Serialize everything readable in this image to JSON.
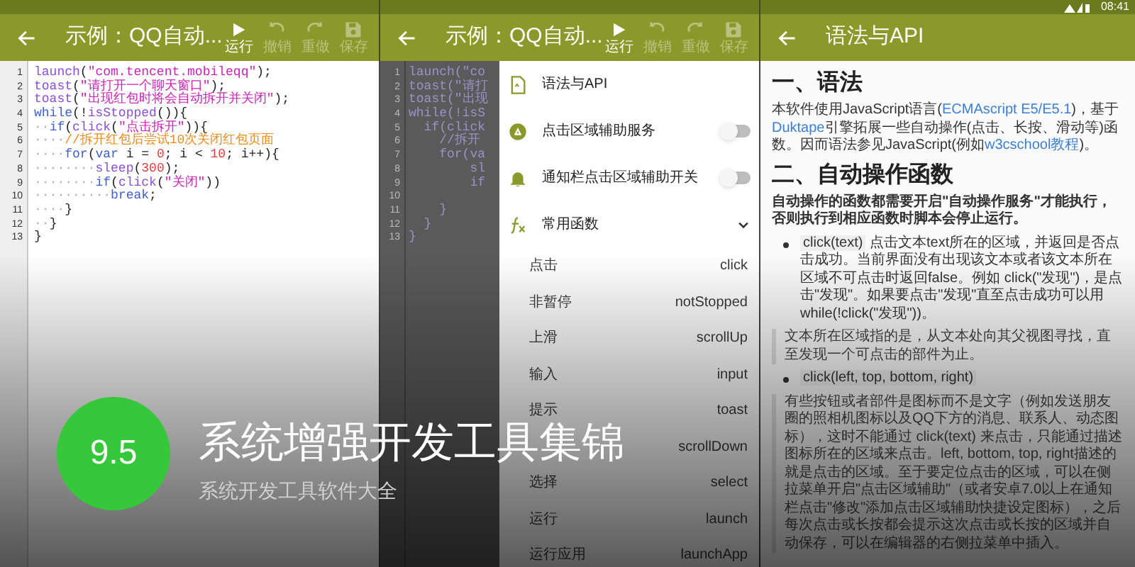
{
  "editor": {
    "toolbar": {
      "title": "示例：QQ自动...",
      "actions": [
        {
          "label": "运行",
          "kind": "play",
          "disabled": false
        },
        {
          "label": "撤销",
          "kind": "undo",
          "disabled": true
        },
        {
          "label": "重做",
          "kind": "redo",
          "disabled": true
        },
        {
          "label": "保存",
          "kind": "save",
          "disabled": true
        }
      ]
    },
    "lines": [
      {
        "num": "1",
        "tokens": [
          {
            "kind": "fn",
            "text": "launch"
          },
          {
            "kind": "plain",
            "text": "("
          },
          {
            "kind": "str",
            "text": "\"com.tencent.mobileqq\""
          },
          {
            "kind": "plain",
            "text": ");"
          }
        ]
      },
      {
        "num": "2",
        "tokens": [
          {
            "kind": "fn",
            "text": "toast"
          },
          {
            "kind": "plain",
            "text": "("
          },
          {
            "kind": "str",
            "text": "\"请打开一个聊天窗口\""
          },
          {
            "kind": "plain",
            "text": ");"
          }
        ]
      },
      {
        "num": "3",
        "tokens": [
          {
            "kind": "fn",
            "text": "toast"
          },
          {
            "kind": "plain",
            "text": "("
          },
          {
            "kind": "str",
            "text": "\"出现红包时将会自动拆开并关闭\""
          },
          {
            "kind": "plain",
            "text": ");"
          }
        ]
      },
      {
        "num": "4",
        "tokens": [
          {
            "kind": "kw",
            "text": "while"
          },
          {
            "kind": "plain",
            "text": "(!"
          },
          {
            "kind": "fn",
            "text": "isStopped"
          },
          {
            "kind": "plain",
            "text": "()){"
          }
        ]
      },
      {
        "num": "5",
        "tokens": [
          {
            "kind": "indent",
            "text": "··"
          },
          {
            "kind": "kw",
            "text": "if"
          },
          {
            "kind": "plain",
            "text": "("
          },
          {
            "kind": "fn",
            "text": "click"
          },
          {
            "kind": "plain",
            "text": "("
          },
          {
            "kind": "str",
            "text": "\"点击拆开\""
          },
          {
            "kind": "plain",
            "text": ")){"
          }
        ]
      },
      {
        "num": "6",
        "tokens": [
          {
            "kind": "indent",
            "text": "····"
          },
          {
            "kind": "comment",
            "text": "//拆开红包后尝试10次关闭红包页面"
          }
        ]
      },
      {
        "num": "7",
        "tokens": [
          {
            "kind": "indent",
            "text": "····"
          },
          {
            "kind": "kw",
            "text": "for"
          },
          {
            "kind": "plain",
            "text": "("
          },
          {
            "kind": "kw",
            "text": "var"
          },
          {
            "kind": "plain",
            "text": " i = "
          },
          {
            "kind": "num",
            "text": "0"
          },
          {
            "kind": "plain",
            "text": "; i < "
          },
          {
            "kind": "num",
            "text": "10"
          },
          {
            "kind": "plain",
            "text": "; i++){"
          }
        ]
      },
      {
        "num": "8",
        "tokens": [
          {
            "kind": "indent",
            "text": "········"
          },
          {
            "kind": "fn",
            "text": "sleep"
          },
          {
            "kind": "plain",
            "text": "("
          },
          {
            "kind": "num",
            "text": "300"
          },
          {
            "kind": "plain",
            "text": ");"
          }
        ]
      },
      {
        "num": "9",
        "tokens": [
          {
            "kind": "indent",
            "text": "········"
          },
          {
            "kind": "kw",
            "text": "if"
          },
          {
            "kind": "plain",
            "text": "("
          },
          {
            "kind": "fn",
            "text": "click"
          },
          {
            "kind": "plain",
            "text": "("
          },
          {
            "kind": "str",
            "text": "\"关闭\""
          },
          {
            "kind": "plain",
            "text": "))"
          }
        ]
      },
      {
        "num": "10",
        "tokens": [
          {
            "kind": "indent",
            "text": "··········"
          },
          {
            "kind": "kw",
            "text": "break"
          },
          {
            "kind": "plain",
            "text": ";"
          }
        ]
      },
      {
        "num": "11",
        "tokens": [
          {
            "kind": "indent",
            "text": "····"
          },
          {
            "kind": "plain",
            "text": "}"
          }
        ]
      },
      {
        "num": "12",
        "tokens": [
          {
            "kind": "indent",
            "text": "··"
          },
          {
            "kind": "plain",
            "text": "}"
          }
        ]
      },
      {
        "num": "13",
        "tokens": [
          {
            "kind": "plain",
            "text": "}"
          }
        ]
      }
    ]
  },
  "menu_screen": {
    "toolbar": {
      "title": "示例：QQ自动...",
      "actions": [
        {
          "label": "运行",
          "kind": "play",
          "disabled": false
        },
        {
          "label": "撤销",
          "kind": "undo",
          "disabled": true
        },
        {
          "label": "重做",
          "kind": "redo",
          "disabled": true
        },
        {
          "label": "保存",
          "kind": "save",
          "disabled": true
        }
      ]
    },
    "lines": [
      {
        "num": "1",
        "text": "launch(\"co"
      },
      {
        "num": "2",
        "text": "toast(\"请打"
      },
      {
        "num": "3",
        "text": "toast(\"出现"
      },
      {
        "num": "4",
        "text": "while(!isS"
      },
      {
        "num": "5",
        "text": "  if(click"
      },
      {
        "num": "6",
        "text": "    //拆开"
      },
      {
        "num": "7",
        "text": "    for(va"
      },
      {
        "num": "8",
        "text": "        sl"
      },
      {
        "num": "9",
        "text": "        if"
      },
      {
        "num": "10"
      },
      {
        "num": "11",
        "text": "    }"
      },
      {
        "num": "12",
        "text": "  }"
      },
      {
        "num": "13",
        "text": "}"
      }
    ],
    "drawer": [
      {
        "kind": "link",
        "label": "语法与API"
      },
      {
        "kind": "toggle",
        "label": "点击区域辅助服务",
        "on": false
      },
      {
        "kind": "toggle",
        "label": "通知栏点击区域辅助开关",
        "on": false
      },
      {
        "kind": "group",
        "label": "常用函数",
        "expanded": true
      }
    ],
    "functions": [
      {
        "label": "点击",
        "name": "click"
      },
      {
        "label": "非暂停",
        "name": "notStopped"
      },
      {
        "label": "上滑",
        "name": "scrollUp"
      },
      {
        "label": "输入",
        "name": "input"
      },
      {
        "label": "提示",
        "name": "toast"
      },
      {
        "name": "scrollDown"
      },
      {
        "label": "选择",
        "name": "select"
      },
      {
        "label": "运行",
        "name": "launch"
      },
      {
        "label": "运行应用",
        "name": "launchApp"
      }
    ]
  },
  "doc_screen": {
    "status_time": "08:41",
    "title": "语法与API",
    "blocks": [
      {
        "kind": "heading",
        "segments": [
          {
            "kind": "text",
            "text": "一、语法"
          }
        ]
      },
      {
        "kind": "para",
        "segments": [
          {
            "kind": "text",
            "text": "本软件使用JavaScript语言("
          },
          {
            "kind": "link",
            "text": "ECMAscript E5/E5.1"
          },
          {
            "kind": "text",
            "text": ")，基于"
          },
          {
            "kind": "link",
            "text": "Duktape"
          },
          {
            "kind": "text",
            "text": "引擎拓展一些自动操作(点击、长按、滑动等)函数。因而语法参见JavaScript(例如"
          },
          {
            "kind": "link",
            "text": "w3cschool教程"
          },
          {
            "kind": "text",
            "text": ")。"
          }
        ]
      },
      {
        "kind": "heading",
        "segments": [
          {
            "kind": "text",
            "text": "二、自动操作函数"
          }
        ]
      },
      {
        "kind": "lead",
        "segments": [
          {
            "kind": "text",
            "text": "自动操作的函数都需要开启\"自动操作服务\"才能执行，否则执行到相应函数时脚本会停止运行。"
          }
        ]
      },
      {
        "kind": "bullet",
        "segments": [
          {
            "kind": "code",
            "text": "click(text)"
          },
          {
            "kind": "text",
            "text": " 点击文本text所在的区域，并返回是否点击成功。当前界面没有出现该文本或者该文本所在区域不可点击时返回false。例如 click(\"发现\")，是点击\"发现\"。如果要点击\"发现\"直至点击成功可以用 while(!click(\"发现\"))。"
          }
        ]
      },
      {
        "kind": "quote",
        "segments": [
          {
            "kind": "text",
            "text": "文本所在区域指的是，从文本处向其父视图寻找，直至发现一个可点击的部件为止。"
          }
        ]
      },
      {
        "kind": "bullet",
        "segments": [
          {
            "kind": "code",
            "text": "click(left, top, bottom, right)"
          }
        ]
      },
      {
        "kind": "quote",
        "segments": [
          {
            "kind": "text",
            "text": "有些按钮或者部件是图标而不是文字（例如发送朋友圈的照相机图标以及QQ下方的消息、联系人、动态图标），这时不能通过 click(text) 来点击，只能通过描述图标所在的区域来点击。left, bottom, top, right描述的就是点击的区域。至于要定位点击的区域，可以在侧拉菜单开启\"点击区域辅助\"（或者安卓7.0以上在通知栏点击\"修改\"添加点击区域辅助快捷设定图标），之后每次点击或长按都会提示这次点击或长按的区域并自动保存，可以在编辑器的右侧拉菜单中插入。"
          }
        ]
      }
    ]
  },
  "banner": {
    "score": "9.5",
    "title": "系统增强开发工具集锦",
    "subtitle": "系统开发工具软件大全"
  }
}
